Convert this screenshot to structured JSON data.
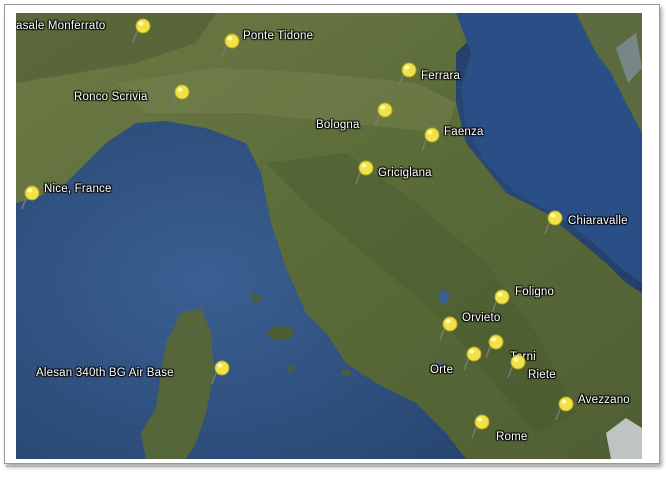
{
  "markers": [
    {
      "id": "casale",
      "label": "asale Monferrato"
    },
    {
      "id": "ponte",
      "label": "Ponte Tidone"
    },
    {
      "id": "ronco",
      "label": "Ronco Scrivia"
    },
    {
      "id": "ferrara",
      "label": "Ferrara"
    },
    {
      "id": "bologna",
      "label": "Bologna"
    },
    {
      "id": "faenza",
      "label": "Faenza"
    },
    {
      "id": "nice",
      "label": "Nice, France"
    },
    {
      "id": "griciglana",
      "label": "Griciglana"
    },
    {
      "id": "chiaravalle",
      "label": "Chiaravalle"
    },
    {
      "id": "foligno",
      "label": "Foligno"
    },
    {
      "id": "orvieto",
      "label": "Orvieto"
    },
    {
      "id": "alesan",
      "label": "Alesan  340th BG Air Base"
    },
    {
      "id": "terni",
      "label": "Terni"
    },
    {
      "id": "orte",
      "label": "Orte"
    },
    {
      "id": "riete",
      "label": "Riete"
    },
    {
      "id": "avezzano",
      "label": "Avezzano"
    },
    {
      "id": "rome",
      "label": "Rome"
    }
  ],
  "colors": {
    "sea": "#33507a",
    "land": "#5f6e3c",
    "pin": "#f2e24a"
  }
}
